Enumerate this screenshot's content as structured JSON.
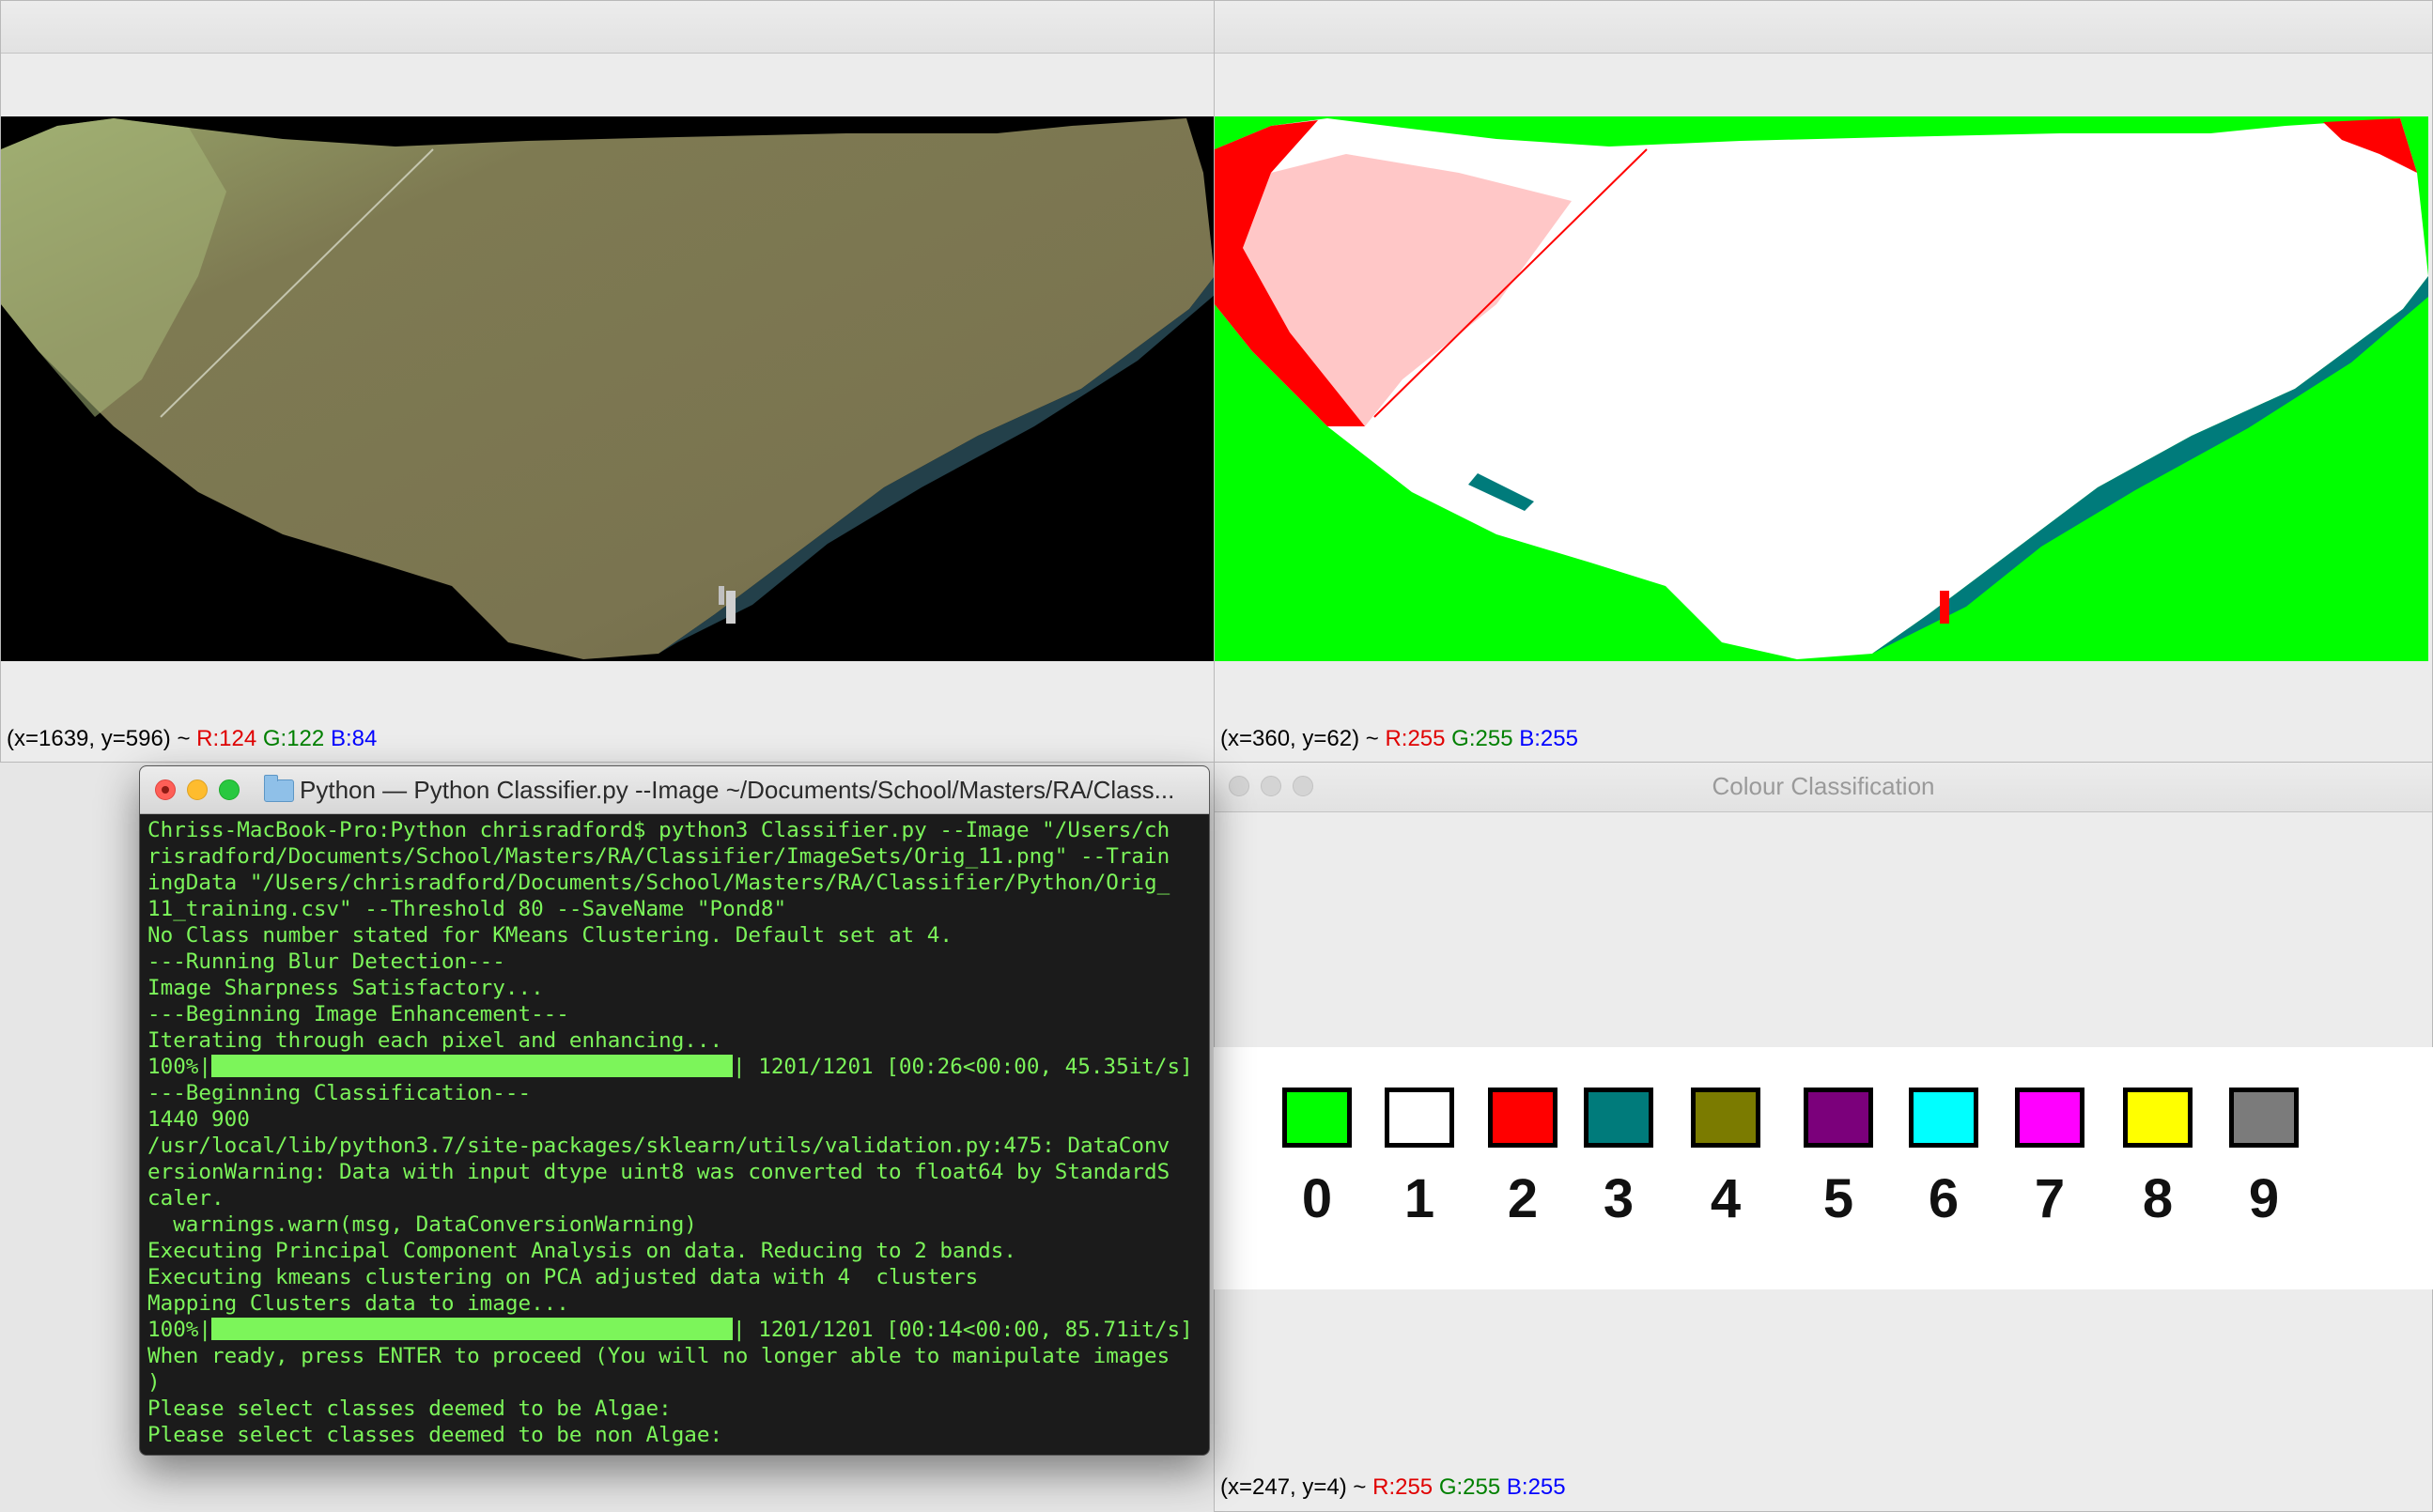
{
  "windows": {
    "original_image": {
      "status": {
        "coords": "(x=1639, y=596)",
        "sep": "~",
        "r": "R:124",
        "g": "G:122",
        "b": "B:84"
      }
    },
    "classified_image": {
      "status": {
        "coords": "(x=360, y=62)",
        "sep": "~",
        "r": "R:255",
        "g": "G:255",
        "b": "B:255"
      }
    },
    "terminal": {
      "title": "Python — Python Classifier.py --Image ~/Documents/School/Masters/RA/Class...",
      "lines": [
        "Chriss-MacBook-Pro:Python chrisradford$ python3 Classifier.py --Image \"/Users/ch",
        "risradford/Documents/School/Masters/RA/Classifier/ImageSets/Orig_11.png\" --Train",
        "ingData \"/Users/chrisradford/Documents/School/Masters/RA/Classifier/Python/Orig_",
        "11_training.csv\" --Threshold 80 --SaveName \"Pond8\"",
        "No Class number stated for KMeans Clustering. Default set at 4.",
        "---Running Blur Detection---",
        "Image Sharpness Satisfactory...",
        "---Beginning Image Enhancement---",
        "Iterating through each pixel and enhancing...",
        "",
        "---Beginning Classification---",
        "1440 900",
        "/usr/local/lib/python3.7/site-packages/sklearn/utils/validation.py:475: DataConv",
        "ersionWarning: Data with input dtype uint8 was converted to float64 by StandardS",
        "caler.",
        "  warnings.warn(msg, DataConversionWarning)",
        "Executing Principal Component Analysis on data. Reducing to 2 bands.",
        "Executing kmeans clustering on PCA adjusted data with 4  clusters",
        "Mapping Clusters data to image...",
        "",
        "When ready, press ENTER to proceed (You will no longer able to manipulate images",
        ")",
        "Please select classes deemed to be Algae:",
        "Please select classes deemed to be non Algae:"
      ],
      "progress1": {
        "prefix": "100%|",
        "suffix": "| 1201/1201 [00:26<00:00, 45.35it/s]",
        "fraction": 1.0
      },
      "progress2": {
        "prefix": "100%|",
        "suffix": "| 1201/1201 [00:14<00:00, 85.71it/s]",
        "fraction": 1.0
      }
    },
    "colour_classification": {
      "title": "Colour Classification",
      "status": {
        "coords": "(x=247, y=4)",
        "sep": "~",
        "r": "R:255",
        "g": "G:255",
        "b": "B:255"
      },
      "classes": [
        {
          "label": "0",
          "color": "#00ff00"
        },
        {
          "label": "1",
          "color": "#ffffff"
        },
        {
          "label": "2",
          "color": "#ff0000"
        },
        {
          "label": "3",
          "color": "#007b7b"
        },
        {
          "label": "4",
          "color": "#7b7b00"
        },
        {
          "label": "5",
          "color": "#7b007b"
        },
        {
          "label": "6",
          "color": "#00ffff"
        },
        {
          "label": "7",
          "color": "#ff00ff"
        },
        {
          "label": "8",
          "color": "#ffff00"
        },
        {
          "label": "9",
          "color": "#7b7b7b"
        }
      ]
    }
  }
}
